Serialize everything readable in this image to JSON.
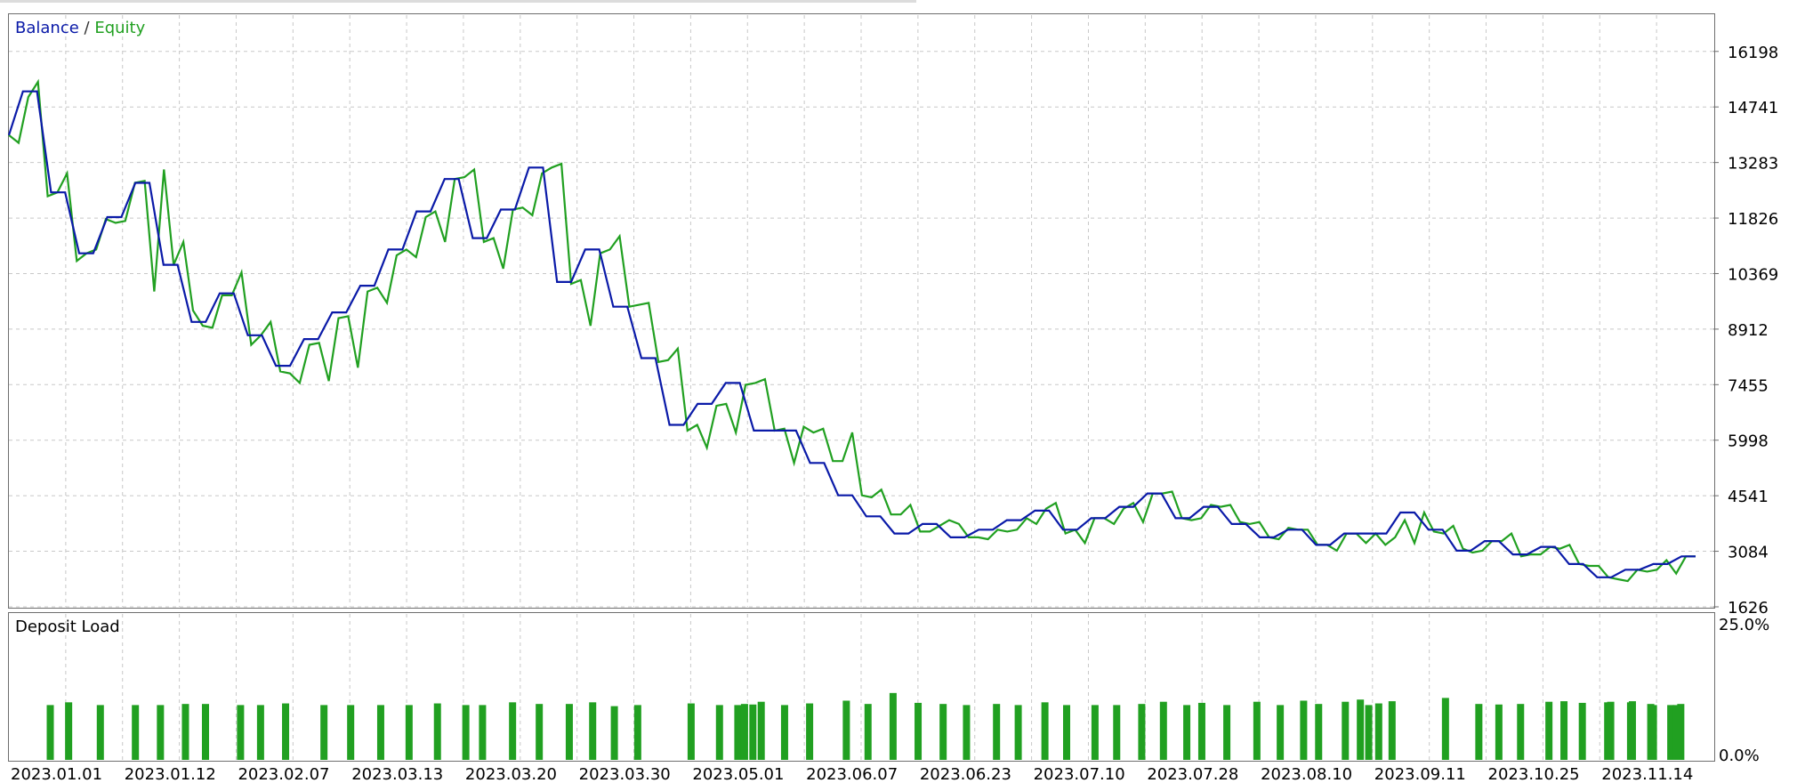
{
  "colors": {
    "balance": "#0a1aa8",
    "equity": "#21a021",
    "bars": "#21a021",
    "grid": "#c8c8c8",
    "border": "#6e6e6e",
    "text": "#000000"
  },
  "legend": {
    "balance": "Balance",
    "separator": "/",
    "equity": "Equity",
    "deposit_load": "Deposit Load"
  },
  "chart_data": [
    {
      "type": "line",
      "title": "Balance / Equity",
      "ylim": [
        1626,
        17150
      ],
      "y_ticks": [
        "16198",
        "14741",
        "13283",
        "11826",
        "10369",
        "8912",
        "7455",
        "5998",
        "4541",
        "3084",
        "1626"
      ],
      "x_ticks": [
        "2023.01.01",
        "2023.01.12",
        "2023.02.07",
        "2023.03.13",
        "2023.03.20",
        "2023.03.30",
        "2023.05.01",
        "2023.06.07",
        "2023.06.23",
        "2023.07.10",
        "2023.07.28",
        "2023.08.10",
        "2023.09.11",
        "2023.10.25",
        "2023.11.14"
      ],
      "grid": true,
      "legend": "top-left",
      "series": [
        {
          "name": "Balance",
          "values": [
            14000,
            15150,
            15150,
            12500,
            12500,
            10900,
            10900,
            11850,
            11850,
            12750,
            12750,
            10600,
            10600,
            9100,
            9100,
            9850,
            9850,
            8750,
            8750,
            7950,
            7950,
            8650,
            8650,
            9350,
            9350,
            10050,
            10050,
            11000,
            11000,
            12000,
            12000,
            12850,
            12850,
            11300,
            11300,
            12050,
            12050,
            13150,
            13150,
            10150,
            10150,
            11000,
            11000,
            9500,
            9500,
            8150,
            8150,
            6400,
            6400,
            6950,
            6950,
            7500,
            7500,
            6250,
            6250,
            6250,
            6250,
            5400,
            5400,
            4550,
            4550,
            4000,
            4000,
            3550,
            3550,
            3800,
            3800,
            3450,
            3450,
            3650,
            3650,
            3900,
            3900,
            4150,
            4150,
            3650,
            3650,
            3950,
            3950,
            4250,
            4250,
            4600,
            4600,
            3950,
            3950,
            4250,
            4250,
            3800,
            3800,
            3450,
            3450,
            3650,
            3650,
            3250,
            3250,
            3550,
            3550,
            3550,
            3550,
            4100,
            4100,
            3650,
            3650,
            3100,
            3100,
            3350,
            3350,
            3000,
            3000,
            3200,
            3200,
            2750,
            2750,
            2400,
            2400,
            2600,
            2600,
            2750,
            2750,
            2950,
            2950
          ],
          "equity": [
            14000,
            13800,
            15000,
            15400,
            12400,
            12500,
            13000,
            10700,
            10900,
            11000,
            11800,
            11700,
            11750,
            12750,
            12800,
            9900,
            13100,
            10600,
            11200,
            9400,
            9000,
            8950,
            9800,
            9800,
            10400,
            8500,
            8750,
            9100,
            7800,
            7750,
            7500,
            8500,
            8550,
            7550,
            9200,
            9250,
            7900,
            9900,
            10000,
            9600,
            10850,
            11000,
            10800,
            11850,
            12000,
            11200,
            12850,
            12900,
            13100,
            11200,
            11300,
            10500,
            12050,
            12100,
            11900,
            13000,
            13150,
            13250,
            10100,
            10200,
            9000,
            10900,
            11000,
            11350,
            9500,
            9550,
            9600,
            8050,
            8100,
            8400,
            6250,
            6400,
            5800,
            6900,
            6950,
            6200,
            7450,
            7500,
            7600,
            6250,
            6300,
            5400,
            6350,
            6200,
            6300,
            5450,
            5450,
            6200,
            4550,
            4500,
            4700,
            4050,
            4050,
            4300,
            3600,
            3600,
            3750,
            3900,
            3800,
            3450,
            3450,
            3400,
            3650,
            3600,
            3650,
            3950,
            3800,
            4200,
            4350,
            3550,
            3650,
            3300,
            3950,
            3950,
            3800,
            4200,
            4350,
            3850,
            4600,
            4600,
            4650,
            3950,
            3900,
            3950,
            4300,
            4250,
            4300,
            3850,
            3800,
            3850,
            3450,
            3400,
            3700,
            3650,
            3650,
            3250,
            3250,
            3100,
            3550,
            3550,
            3300,
            3550,
            3250,
            3450,
            3900,
            3300,
            4100,
            3600,
            3550,
            3750,
            3150,
            3050,
            3100,
            3350,
            3350,
            3550,
            2950,
            3000,
            3000,
            3200,
            3150,
            3250,
            2750,
            2700,
            2700,
            2400,
            2350,
            2300,
            2600,
            2550,
            2600,
            2850,
            2500,
            2950,
            2950
          ]
        }
      ]
    },
    {
      "type": "bar",
      "title": "Deposit Load",
      "ylim": [
        0,
        25
      ],
      "y_ticks": [
        "25.0%",
        "0.0%"
      ],
      "values": [
        10,
        10.5,
        10,
        10,
        10,
        10.2,
        10.2,
        10,
        10,
        10.3,
        10,
        10,
        10,
        10,
        10.3,
        10,
        10,
        10.5,
        10.2,
        10.2,
        10.5,
        9.8,
        10,
        10.3,
        10,
        10,
        10.2,
        10.1,
        10.6,
        10,
        10.3,
        10.8,
        10.2,
        12.2,
        10.4,
        10.2,
        10,
        10.2,
        10,
        10.5,
        10,
        10,
        10,
        10.2,
        10.6,
        10,
        10.4,
        10,
        10.6,
        10,
        10.8,
        10.2,
        10.6,
        11,
        10,
        10.3,
        10.7,
        11.3,
        10.2,
        10.1,
        10.2,
        10.6,
        10.7,
        10.4,
        10.6,
        10.7,
        10.2,
        10,
        10.2,
        10.5,
        10.5,
        10,
        10
      ],
      "positions": [
        0.012,
        0.023,
        0.042,
        0.063,
        0.078,
        0.093,
        0.105,
        0.126,
        0.138,
        0.153,
        0.176,
        0.192,
        0.21,
        0.227,
        0.244,
        0.261,
        0.271,
        0.289,
        0.305,
        0.323,
        0.337,
        0.35,
        0.364,
        0.396,
        0.413,
        0.424,
        0.428,
        0.433,
        0.438,
        0.452,
        0.467,
        0.489,
        0.502,
        0.517,
        0.532,
        0.547,
        0.561,
        0.579,
        0.592,
        0.608,
        0.621,
        0.638,
        0.651,
        0.666,
        0.679,
        0.693,
        0.702,
        0.717,
        0.735,
        0.749,
        0.763,
        0.772,
        0.788,
        0.797,
        0.802,
        0.808,
        0.816,
        0.848,
        0.868,
        0.88,
        0.893,
        0.91,
        0.919,
        0.93,
        0.947,
        0.96,
        0.971,
        0.983,
        0.989
      ]
    }
  ]
}
